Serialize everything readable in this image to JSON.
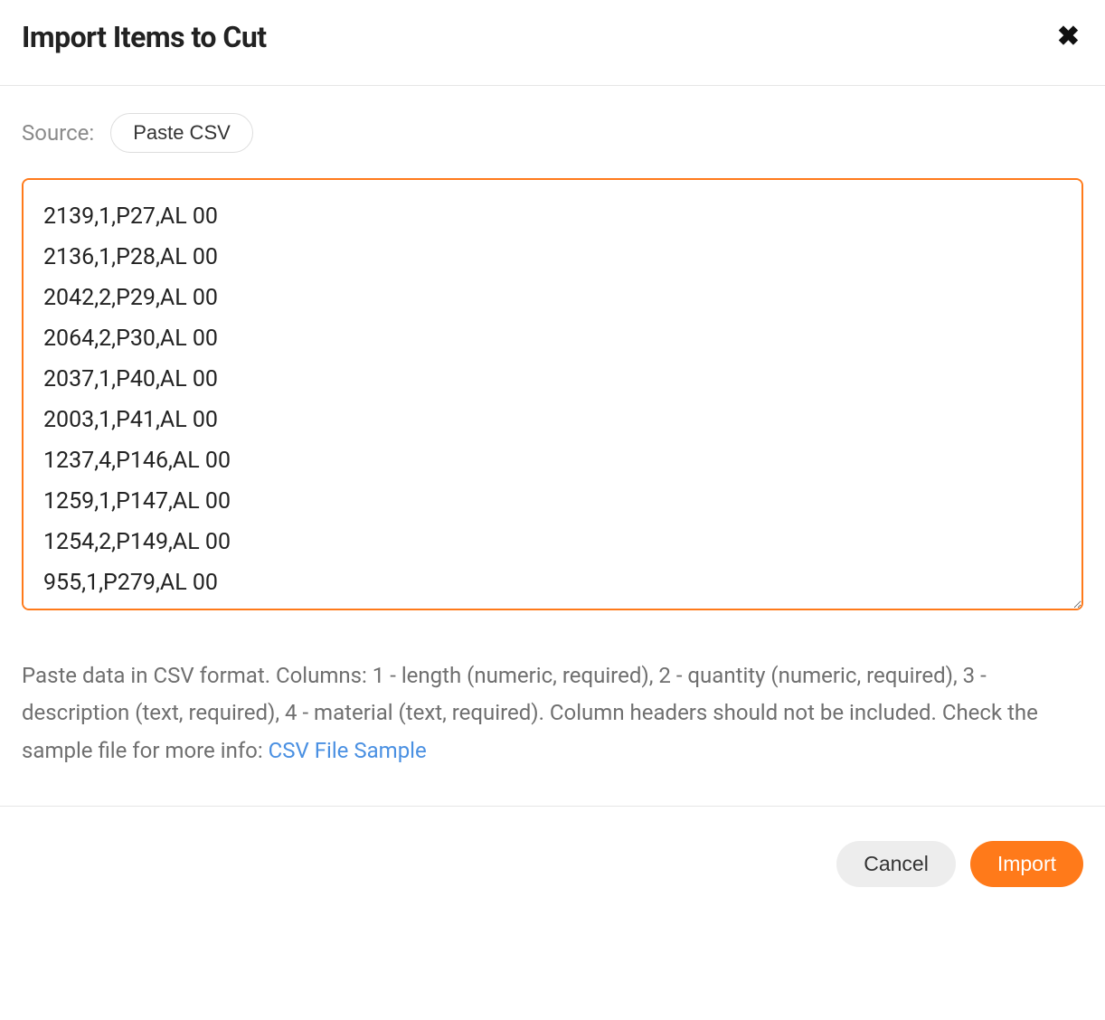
{
  "modal": {
    "title": "Import Items to Cut"
  },
  "source": {
    "label": "Source:",
    "selected": "Paste CSV"
  },
  "textarea": {
    "value": "2139,1,P27,AL 00\n2136,1,P28,AL 00\n2042,2,P29,AL 00\n2064,2,P30,AL 00\n2037,1,P40,AL 00\n2003,1,P41,AL 00\n1237,4,P146,AL 00\n1259,1,P147,AL 00\n1254,2,P149,AL 00\n955,1,P279,AL 00"
  },
  "help": {
    "text": "Paste data in CSV format. Columns: 1 - length (numeric, required), 2 - quantity (numeric, required), 3 - description (text, required), 4 - material (text, required). Column headers should not be included. Check the sample file for more info: ",
    "link_text": "CSV File Sample"
  },
  "footer": {
    "cancel_label": "Cancel",
    "import_label": "Import"
  },
  "icons": {
    "close": "✖"
  }
}
